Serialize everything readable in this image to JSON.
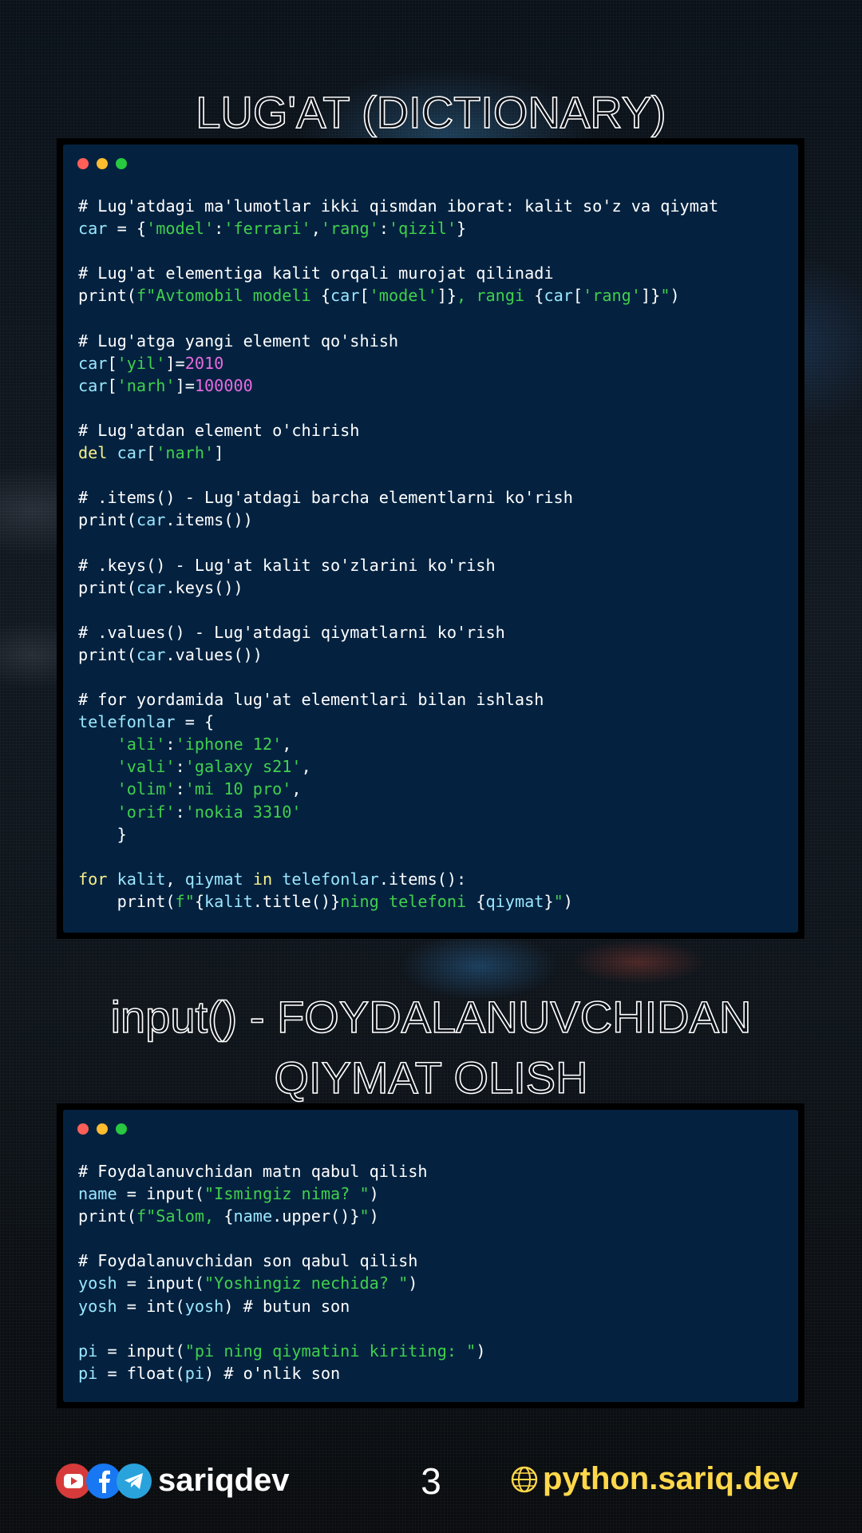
{
  "title_1": "LUG'AT (DICTIONARY)",
  "title_2_line1": "input() - FOYDALANUVCHIDAN",
  "title_2_line2": "QIYMAT OLISH",
  "colors": {
    "code_bg": "#042240",
    "string": "#41cf4d",
    "variable": "#9be7ff",
    "number": "#e76bdf",
    "keyword": "#f7f08a",
    "site_text": "#ffd84a"
  },
  "code_block_1": [
    [
      [
        "d",
        "# Lug'atdagi ma'lumotlar ikki qismdan iborat: kalit so'z va qiymat"
      ]
    ],
    [
      [
        "v",
        "car"
      ],
      [
        "d",
        " = {"
      ],
      [
        "s",
        "'model'"
      ],
      [
        "d",
        ":"
      ],
      [
        "s",
        "'ferrari'"
      ],
      [
        "d",
        ","
      ],
      [
        "s",
        "'rang'"
      ],
      [
        "d",
        ":"
      ],
      [
        "s",
        "'qizil'"
      ],
      [
        "d",
        "}"
      ]
    ],
    [],
    [
      [
        "d",
        "# Lug'at elementiga kalit orqali murojat qilinadi"
      ]
    ],
    [
      [
        "d",
        "print("
      ],
      [
        "s",
        "f\"Avtomobil modeli "
      ],
      [
        "d",
        "{"
      ],
      [
        "v",
        "car"
      ],
      [
        "d",
        "["
      ],
      [
        "s",
        "'model'"
      ],
      [
        "d",
        "]}"
      ],
      [
        "s",
        ", rangi "
      ],
      [
        "d",
        "{"
      ],
      [
        "v",
        "car"
      ],
      [
        "d",
        "["
      ],
      [
        "s",
        "'rang'"
      ],
      [
        "d",
        "]}"
      ],
      [
        "s",
        "\""
      ],
      [
        "d",
        ")"
      ]
    ],
    [],
    [
      [
        "d",
        "# Lug'atga yangi element qo'shish"
      ]
    ],
    [
      [
        "v",
        "car"
      ],
      [
        "d",
        "["
      ],
      [
        "s",
        "'yil'"
      ],
      [
        "d",
        "]="
      ],
      [
        "n",
        "2010"
      ]
    ],
    [
      [
        "v",
        "car"
      ],
      [
        "d",
        "["
      ],
      [
        "s",
        "'narh'"
      ],
      [
        "d",
        "]="
      ],
      [
        "n",
        "100000"
      ]
    ],
    [],
    [
      [
        "d",
        "# Lug'atdan element o'chirish"
      ]
    ],
    [
      [
        "k",
        "del"
      ],
      [
        "d",
        " "
      ],
      [
        "v",
        "car"
      ],
      [
        "d",
        "["
      ],
      [
        "s",
        "'narh'"
      ],
      [
        "d",
        "]"
      ]
    ],
    [],
    [
      [
        "d",
        "# .items() - Lug'atdagi barcha elementlarni ko'rish"
      ]
    ],
    [
      [
        "d",
        "print("
      ],
      [
        "v",
        "car"
      ],
      [
        "d",
        ".items())"
      ]
    ],
    [],
    [
      [
        "d",
        "# .keys() - Lug'at kalit so'zlarini ko'rish"
      ]
    ],
    [
      [
        "d",
        "print("
      ],
      [
        "v",
        "car"
      ],
      [
        "d",
        ".keys())"
      ]
    ],
    [],
    [
      [
        "d",
        "# .values() - Lug'atdagi qiymatlarni ko'rish"
      ]
    ],
    [
      [
        "d",
        "print("
      ],
      [
        "v",
        "car"
      ],
      [
        "d",
        ".values())"
      ]
    ],
    [],
    [
      [
        "d",
        "# for yordamida lug'at elementlari bilan ishlash"
      ]
    ],
    [
      [
        "v",
        "telefonlar"
      ],
      [
        "d",
        " = {"
      ]
    ],
    [
      [
        "d",
        "    "
      ],
      [
        "s",
        "'ali'"
      ],
      [
        "d",
        ":"
      ],
      [
        "s",
        "'iphone 12'"
      ],
      [
        "d",
        ","
      ]
    ],
    [
      [
        "d",
        "    "
      ],
      [
        "s",
        "'vali'"
      ],
      [
        "d",
        ":"
      ],
      [
        "s",
        "'galaxy s21'"
      ],
      [
        "d",
        ","
      ]
    ],
    [
      [
        "d",
        "    "
      ],
      [
        "s",
        "'olim'"
      ],
      [
        "d",
        ":"
      ],
      [
        "s",
        "'mi 10 pro'"
      ],
      [
        "d",
        ","
      ]
    ],
    [
      [
        "d",
        "    "
      ],
      [
        "s",
        "'orif'"
      ],
      [
        "d",
        ":"
      ],
      [
        "s",
        "'nokia 3310'"
      ]
    ],
    [
      [
        "d",
        "    }"
      ]
    ],
    [],
    [
      [
        "k",
        "for"
      ],
      [
        "d",
        " "
      ],
      [
        "v",
        "kalit"
      ],
      [
        "d",
        ", "
      ],
      [
        "v",
        "qiymat"
      ],
      [
        "d",
        " "
      ],
      [
        "k",
        "in"
      ],
      [
        "d",
        " "
      ],
      [
        "v",
        "telefonlar"
      ],
      [
        "d",
        ".items():"
      ]
    ],
    [
      [
        "d",
        "    print("
      ],
      [
        "s",
        "f\""
      ],
      [
        "d",
        "{"
      ],
      [
        "v",
        "kalit"
      ],
      [
        "d",
        ".title()}"
      ],
      [
        "s",
        "ning telefoni "
      ],
      [
        "d",
        "{"
      ],
      [
        "v",
        "qiymat"
      ],
      [
        "d",
        "}"
      ],
      [
        "s",
        "\""
      ],
      [
        "d",
        ")"
      ]
    ]
  ],
  "code_block_2": [
    [
      [
        "d",
        "# Foydalanuvchidan matn qabul qilish"
      ]
    ],
    [
      [
        "v",
        "name"
      ],
      [
        "d",
        " = input("
      ],
      [
        "s",
        "\"Ismingiz nima? \""
      ],
      [
        "d",
        ")"
      ]
    ],
    [
      [
        "d",
        "print("
      ],
      [
        "s",
        "f\"Salom, "
      ],
      [
        "d",
        "{"
      ],
      [
        "v",
        "name"
      ],
      [
        "d",
        ".upper()}"
      ],
      [
        "s",
        "\""
      ],
      [
        "d",
        ")"
      ]
    ],
    [],
    [
      [
        "d",
        "# Foydalanuvchidan son qabul qilish"
      ]
    ],
    [
      [
        "v",
        "yosh"
      ],
      [
        "d",
        " = input("
      ],
      [
        "s",
        "\"Yoshingiz nechida? \""
      ],
      [
        "d",
        ")"
      ]
    ],
    [
      [
        "v",
        "yosh"
      ],
      [
        "d",
        " = int("
      ],
      [
        "v",
        "yosh"
      ],
      [
        "d",
        ") # butun son"
      ]
    ],
    [],
    [
      [
        "v",
        "pi"
      ],
      [
        "d",
        " = input("
      ],
      [
        "s",
        "\"pi ning qiymatini kiriting: \""
      ],
      [
        "d",
        ")"
      ]
    ],
    [
      [
        "v",
        "pi"
      ],
      [
        "d",
        " = float("
      ],
      [
        "v",
        "pi"
      ],
      [
        "d",
        ") # o'nlik son"
      ]
    ]
  ],
  "footer": {
    "icons": [
      "youtube-icon",
      "facebook-icon",
      "telegram-icon",
      "globe-icon"
    ],
    "brand": "sariqdev",
    "page_number": "3",
    "site": "python.sariq.dev"
  }
}
